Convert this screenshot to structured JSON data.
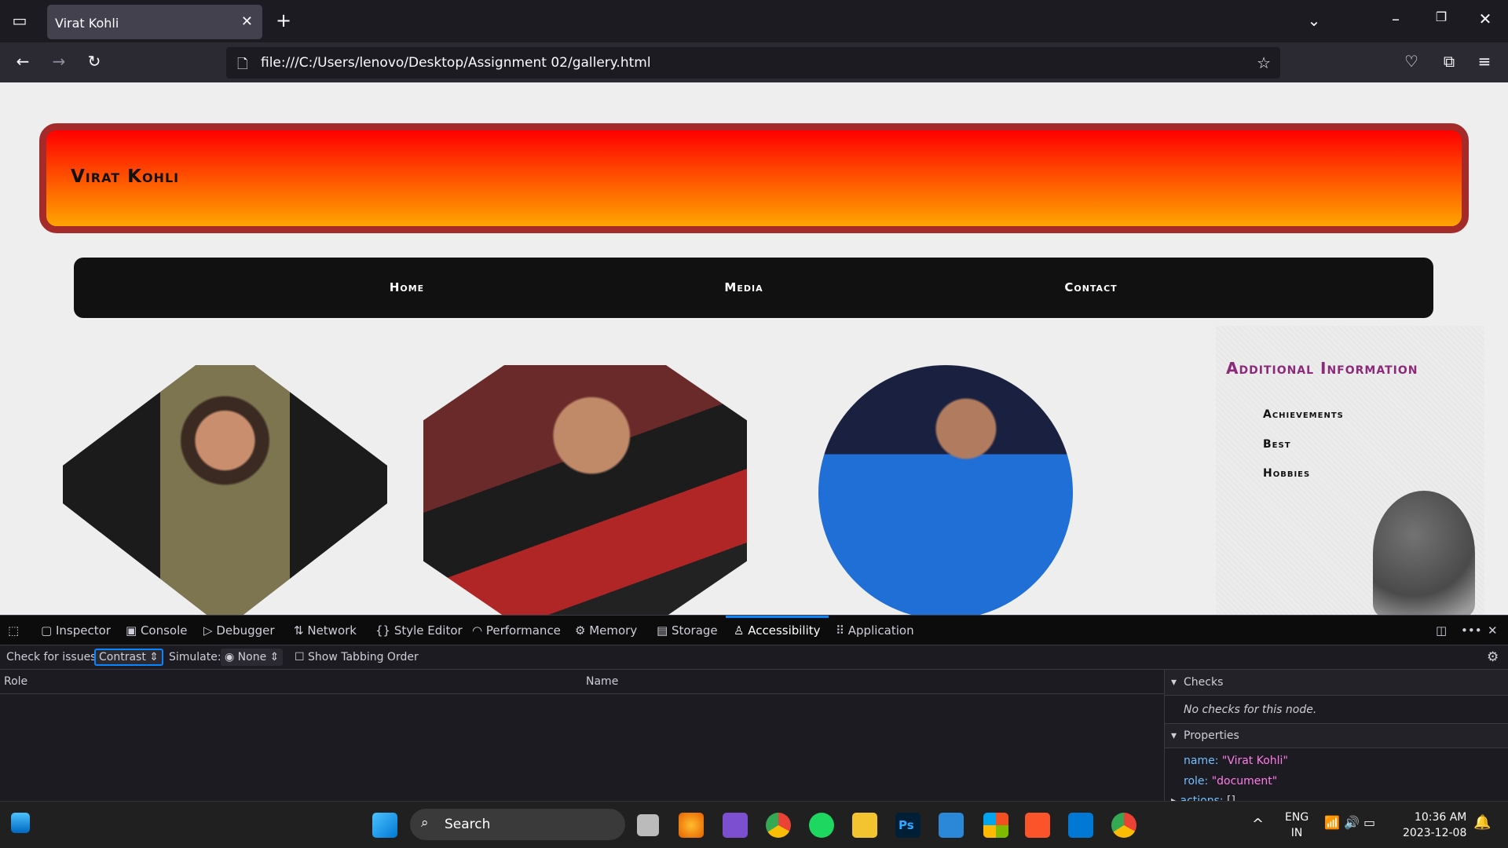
{
  "browser": {
    "tab_title": "Virat Kohli",
    "url": "file:///C:/Users/lenovo/Desktop/Assignment 02/gallery.html"
  },
  "page": {
    "header_title": "Virat Kohli",
    "nav": [
      "Home",
      "Media",
      "Contact"
    ],
    "sidebar": {
      "title": "Additional Information",
      "items": [
        "Achievements",
        "Best",
        "Hobbies"
      ]
    },
    "colors": {
      "header_gradient_top": "#ff0000",
      "header_gradient_bottom": "#ffa500",
      "header_border": "#a52a2a",
      "nav_bg": "#111111",
      "sidebar_title": "#8b2a7a"
    }
  },
  "devtools": {
    "tabs": [
      "Inspector",
      "Console",
      "Debugger",
      "Network",
      "Style Editor",
      "Performance",
      "Memory",
      "Storage",
      "Accessibility",
      "Application"
    ],
    "active_tab": "Accessibility",
    "check_label": "Check for issues:",
    "check_value": "Contrast",
    "simulate_label": "Simulate:",
    "simulate_value": "None",
    "tabbing_label": "Show Tabbing Order",
    "columns": [
      "Role",
      "Name"
    ],
    "checks_header": "Checks",
    "checks_text": "No checks for this node.",
    "properties_header": "Properties",
    "props": [
      {
        "key": "name:",
        "value": "\"Virat Kohli\""
      },
      {
        "key": "role:",
        "value": "\"document\""
      },
      {
        "key": "actions:",
        "value": "[]"
      }
    ]
  },
  "taskbar": {
    "search": "Search",
    "lang1": "ENG",
    "lang2": "IN",
    "time": "10:36 AM",
    "date": "2023-12-08"
  }
}
